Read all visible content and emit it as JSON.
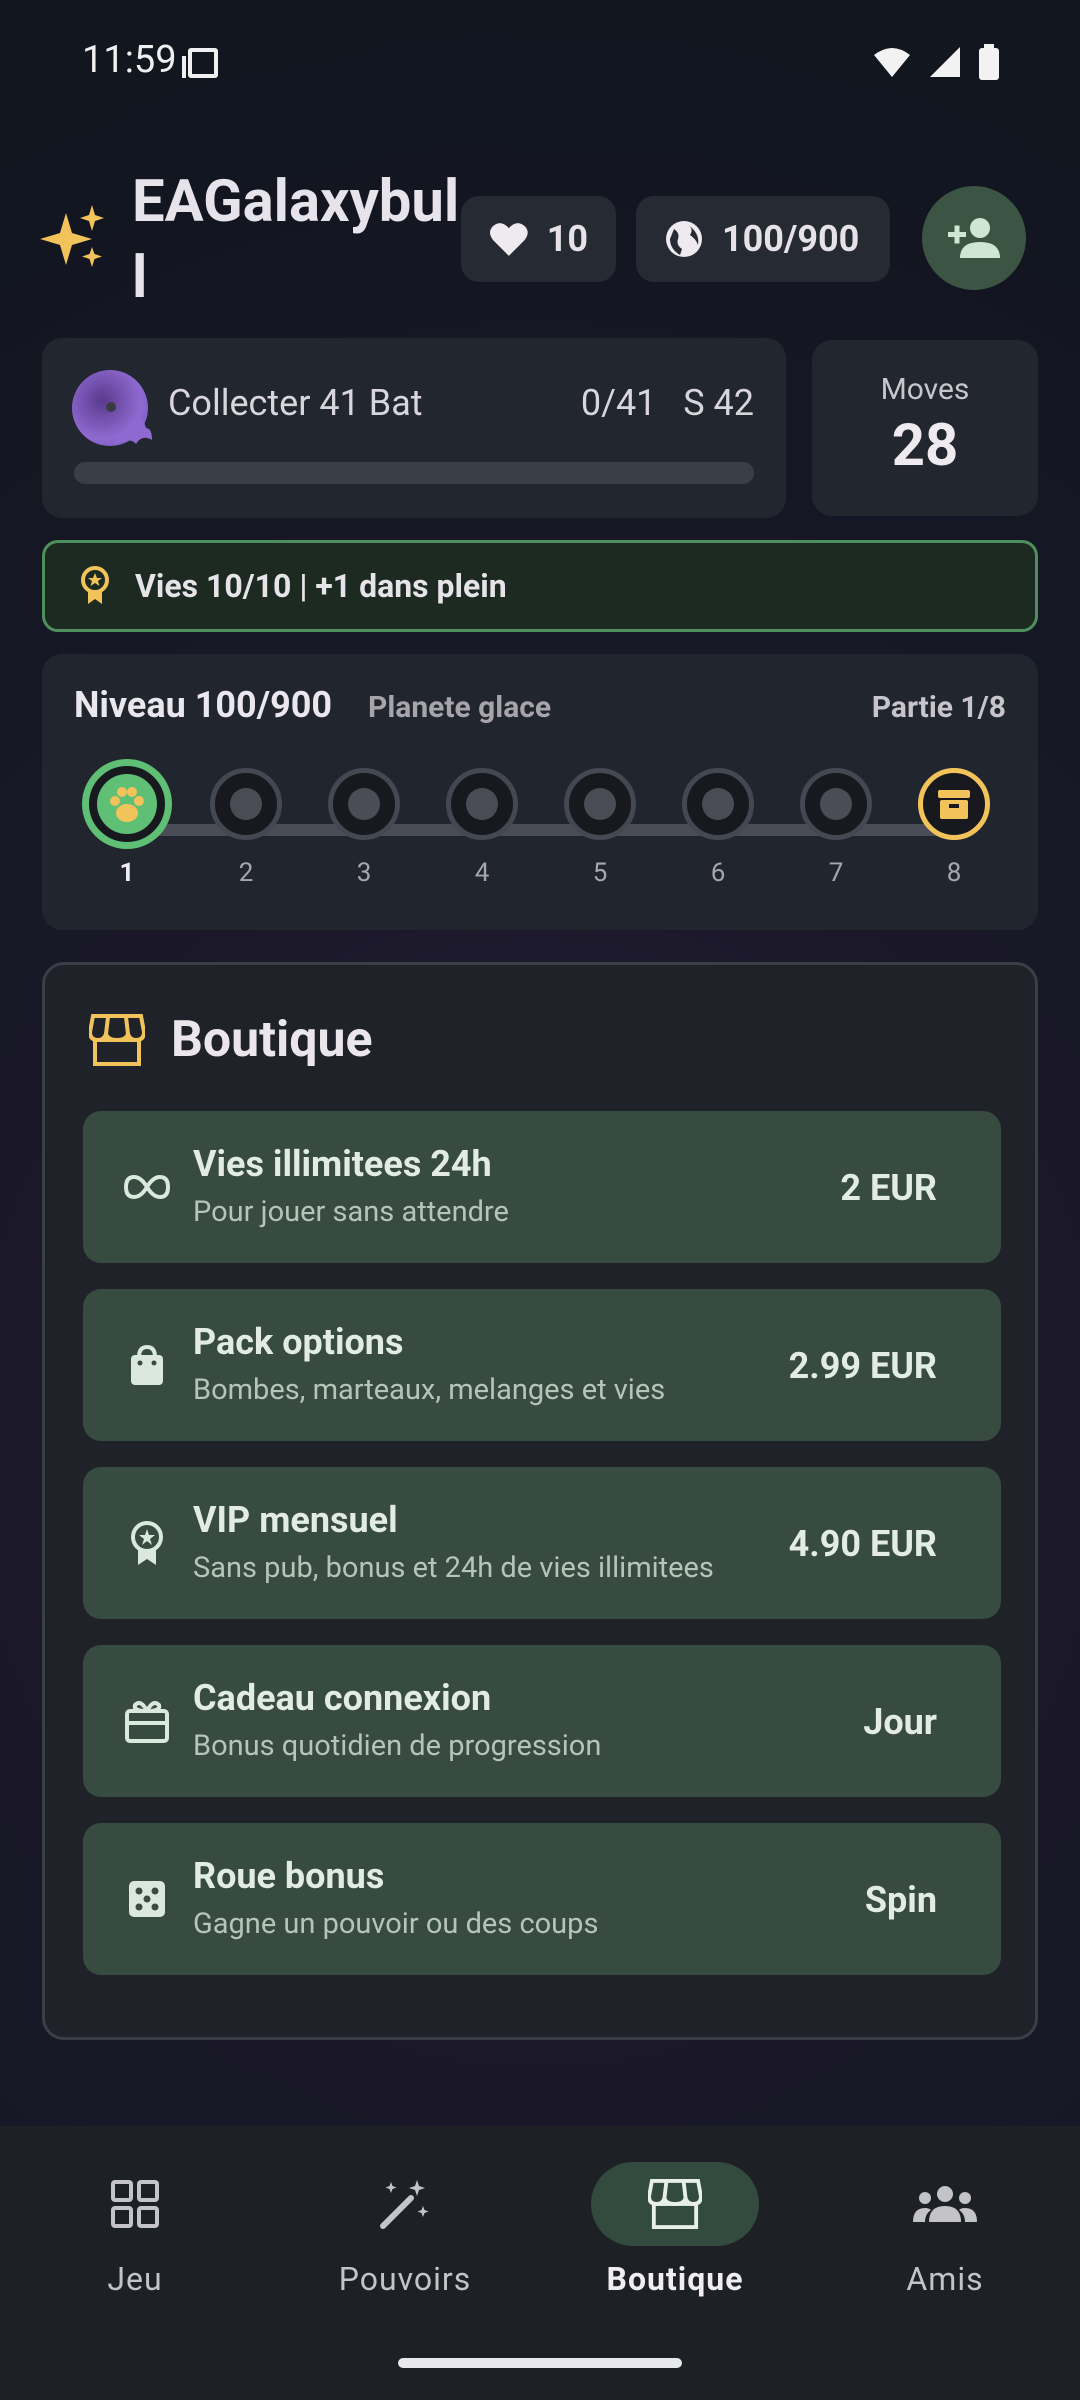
{
  "status_bar": {
    "time": "11:59"
  },
  "header": {
    "username": "EAGalaxybull",
    "hearts": "10",
    "world_progress": "100/900"
  },
  "collect": {
    "title": "Collecter 41 Bat",
    "count": "0/41",
    "stage": "S 42",
    "progress": 0
  },
  "moves": {
    "label": "Moves",
    "value": "28"
  },
  "lives_banner": {
    "text": "Vies 10/10 | +1 dans plein"
  },
  "level": {
    "title": "Niveau 100/900",
    "subtitle": "Planete glace",
    "part": "Partie 1/8",
    "nodes": [
      "1",
      "2",
      "3",
      "4",
      "5",
      "6",
      "7",
      "8"
    ],
    "current": 1
  },
  "shop": {
    "title": "Boutique",
    "items": [
      {
        "icon": "infinity-icon",
        "name": "Vies illimitees 24h",
        "desc": "Pour jouer sans attendre",
        "price": "2 EUR"
      },
      {
        "icon": "shopping-bag-icon",
        "name": "Pack options",
        "desc": "Bombes, marteaux, melanges et vies",
        "price": "2.99 EUR"
      },
      {
        "icon": "award-badge-icon",
        "name": "VIP mensuel",
        "desc": "Sans pub, bonus et 24h de vies illimitees",
        "price": "4.90 EUR"
      },
      {
        "icon": "gift-icon",
        "name": "Cadeau connexion",
        "desc": "Bonus quotidien de progression",
        "price": "Jour"
      },
      {
        "icon": "dice-icon",
        "name": "Roue bonus",
        "desc": "Gagne un pouvoir ou des coups",
        "price": "Spin"
      }
    ]
  },
  "nav": {
    "items": [
      {
        "label": "Jeu",
        "icon": "grid-icon"
      },
      {
        "label": "Pouvoirs",
        "icon": "magic-wand-icon"
      },
      {
        "label": "Boutique",
        "icon": "storefront-icon"
      },
      {
        "label": "Amis",
        "icon": "group-icon"
      }
    ],
    "active": "Boutique"
  },
  "colors": {
    "accent_green": "#5fbf75",
    "gold": "#f1c35a",
    "shop_item_bg": "#374b40"
  }
}
